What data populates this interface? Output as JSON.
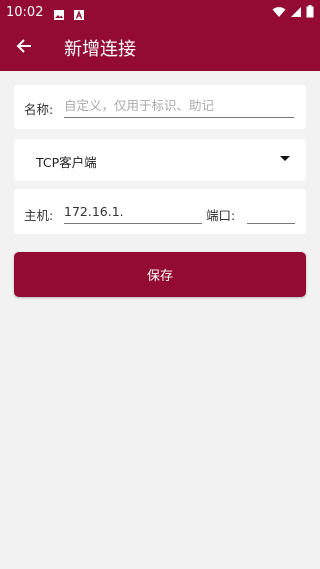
{
  "status_bar": {
    "time": "10:02",
    "icons": [
      "image-icon",
      "text-a-icon",
      "wifi-icon",
      "signal-icon",
      "battery-icon"
    ]
  },
  "app_bar": {
    "title": "新增连接",
    "back_icon": "arrow-left-icon"
  },
  "form": {
    "name": {
      "label": "名称:",
      "placeholder": "自定义，仅用于标识、助记",
      "value": ""
    },
    "type": {
      "selected": "TCP客户端"
    },
    "host": {
      "label": "主机:",
      "value": "172.16.1."
    },
    "port": {
      "label": "端口:",
      "value": ""
    }
  },
  "actions": {
    "save_label": "保存"
  },
  "colors": {
    "primary": "#930b32",
    "background": "#f2f2f2"
  }
}
